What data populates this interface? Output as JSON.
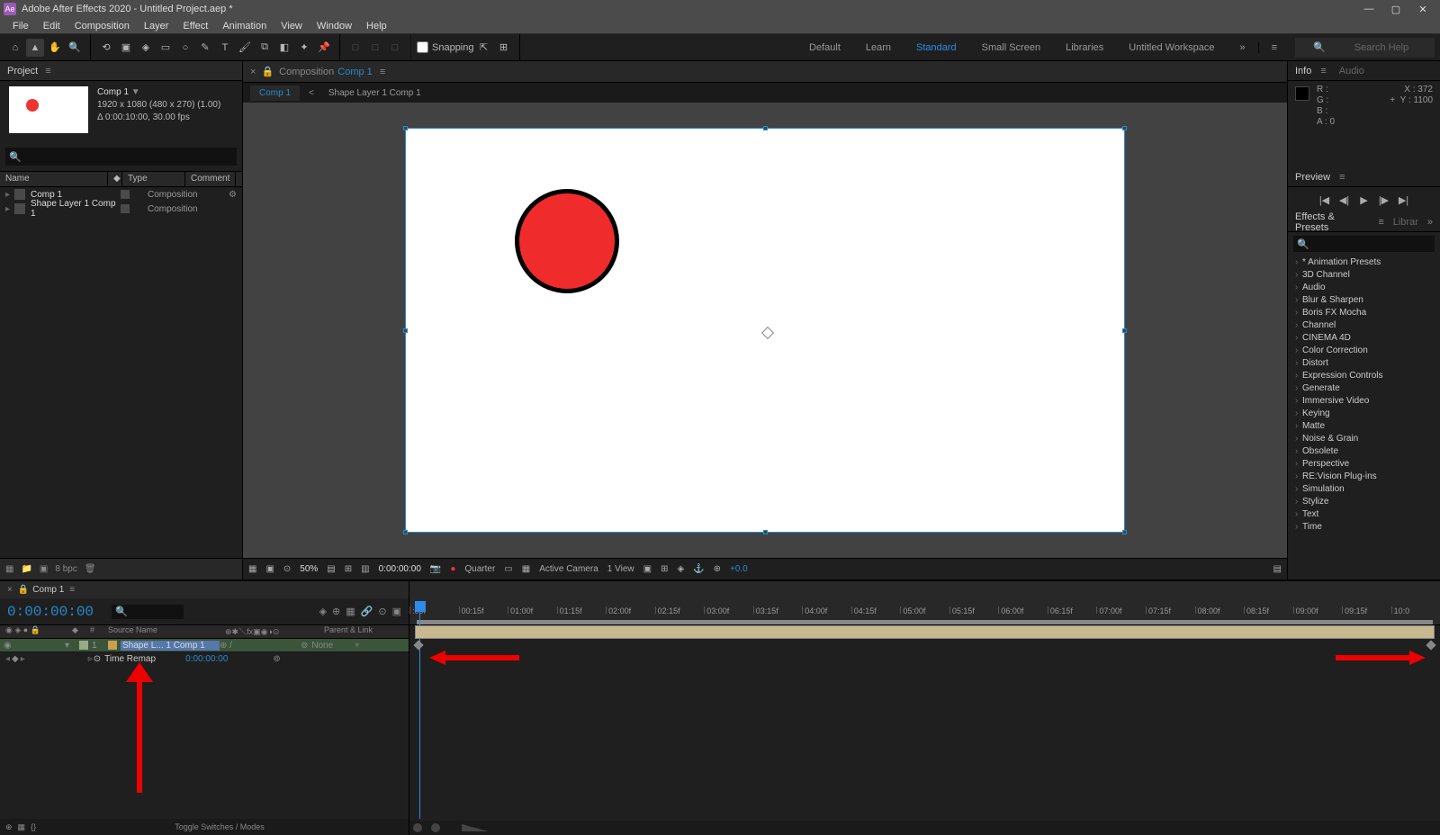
{
  "title": "Adobe After Effects 2020 - Untitled Project.aep *",
  "menu": [
    "File",
    "Edit",
    "Composition",
    "Layer",
    "Effect",
    "Animation",
    "View",
    "Window",
    "Help"
  ],
  "snapping": "Snapping",
  "workspaces": [
    "Default",
    "Learn",
    "Standard",
    "Small Screen",
    "Libraries",
    "Untitled Workspace"
  ],
  "workspace_active": "Standard",
  "search_placeholder": "Search Help",
  "project": {
    "tab": "Project",
    "comp_name": "Comp 1",
    "dims": "1920 x 1080  (480 x 270) (1.00)",
    "dur": "Δ 0:00:10:00, 30.00 fps",
    "cols": {
      "name": "Name",
      "type": "Type",
      "comment": "Comment"
    },
    "items": [
      {
        "name": "Comp 1",
        "type": "Composition"
      },
      {
        "name": "Shape Layer 1 Comp 1",
        "type": "Composition"
      }
    ],
    "bpc": "8 bpc"
  },
  "comp_panel": {
    "label": "Composition",
    "name": "Comp 1",
    "flow": [
      "Comp 1",
      "Shape Layer 1 Comp 1"
    ]
  },
  "viewer_foot": {
    "zoom": "50%",
    "time": "0:00:00:00",
    "res": "Quarter",
    "camera": "Active Camera",
    "views": "1 View",
    "exp": "+0.0"
  },
  "info": {
    "tab1": "Info",
    "tab2": "Audio",
    "r": "R :",
    "g": "G :",
    "b": "B :",
    "a": "A : 0",
    "x": "X : 372",
    "y": "Y : 1100",
    "plus": "+"
  },
  "preview": {
    "tab": "Preview"
  },
  "effects": {
    "tab1": "Effects & Presets",
    "tab2": "Librar",
    "items": [
      "* Animation Presets",
      "3D Channel",
      "Audio",
      "Blur & Sharpen",
      "Boris FX Mocha",
      "Channel",
      "CINEMA 4D",
      "Color Correction",
      "Distort",
      "Expression Controls",
      "Generate",
      "Immersive Video",
      "Keying",
      "Matte",
      "Noise & Grain",
      "Obsolete",
      "Perspective",
      "RE:Vision Plug-ins",
      "Simulation",
      "Stylize",
      "Text",
      "Time"
    ]
  },
  "timeline": {
    "comp": "Comp 1",
    "timecode": "0:00:00:00",
    "col_src": "Source Name",
    "col_parent": "Parent & Link",
    "layer_num": "1",
    "layer_name": "Shape L... 1 Comp 1",
    "layer_sw": "⊕   /",
    "parent": "None",
    "prop": "Time Remap",
    "prop_val": "0:00:00:00",
    "toggle": "Toggle Switches / Modes",
    "ticks": [
      ":00f",
      "00:15f",
      "01:00f",
      "01:15f",
      "02:00f",
      "02:15f",
      "03:00f",
      "03:15f",
      "04:00f",
      "04:15f",
      "05:00f",
      "05:15f",
      "06:00f",
      "06:15f",
      "07:00f",
      "07:15f",
      "08:00f",
      "08:15f",
      "09:00f",
      "09:15f",
      "10:0"
    ]
  }
}
